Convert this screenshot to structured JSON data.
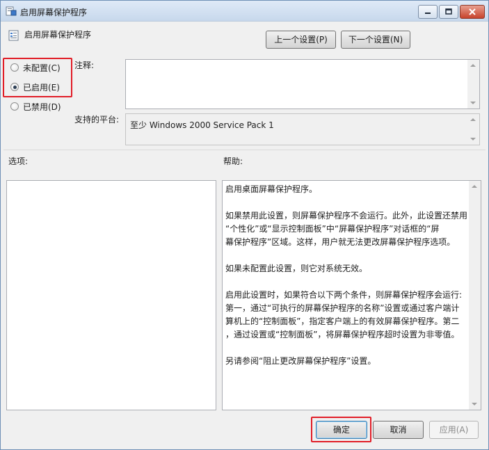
{
  "window": {
    "title": "启用屏幕保护程序"
  },
  "header": {
    "setting_title": "启用屏幕保护程序",
    "prev_button": "上一个设置(P)",
    "next_button": "下一个设置(N)"
  },
  "state": {
    "options": [
      {
        "label": "未配置(C)",
        "checked": false
      },
      {
        "label": "已启用(E)",
        "checked": true
      },
      {
        "label": "已禁用(D)",
        "checked": false
      }
    ]
  },
  "comment": {
    "label": "注释:",
    "value": ""
  },
  "platform": {
    "label": "支持的平台:",
    "value": "至少 Windows 2000 Service Pack 1"
  },
  "options_section": {
    "label": "选项:"
  },
  "help_section": {
    "label": "帮助:",
    "paragraphs": [
      "启用桌面屏幕保护程序。",
      "如果禁用此设置，则屏幕保护程序不会运行。此外，此设置还禁用\n“个性化”或“显示控制面板”中“屏幕保护程序”对话框的“屏\n幕保护程序”区域。这样，用户就无法更改屏幕保护程序选项。",
      "如果未配置此设置，则它对系统无效。",
      "启用此设置时，如果符合以下两个条件，则屏幕保护程序会运行:\n第一，通过“可执行的屏幕保护程序的名称”设置或通过客户端计\n算机上的“控制面板”，指定客户端上的有效屏幕保护程序。第二\n，通过设置或“控制面板”，将屏幕保护程序超时设置为非零值。",
      "另请参阅“阻止更改屏幕保护程序”设置。"
    ]
  },
  "footer": {
    "ok": "确定",
    "cancel": "取消",
    "apply": "应用(A)"
  },
  "icons": {
    "title": "policy-window-icon",
    "setting": "policy-setting-icon",
    "minimize": "minimize-icon",
    "maximize": "maximize-icon",
    "close": "close-icon"
  },
  "colors": {
    "highlight": "#e11c26",
    "close_button": "#c7432c"
  }
}
